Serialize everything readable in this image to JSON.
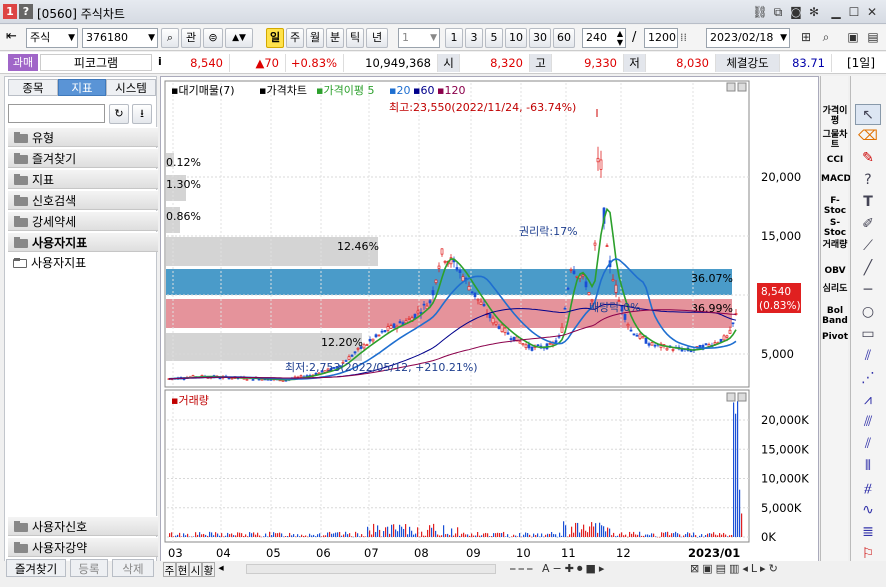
{
  "window": {
    "screen_no": "[0560]",
    "title": "주식차트",
    "badge1": "1",
    "badge2": "?"
  },
  "toolbar": {
    "market": "주식",
    "code": "376180",
    "btn_gwan": "관",
    "periods": [
      "일",
      "주",
      "월",
      "분",
      "틱",
      "년"
    ],
    "active_period": "일",
    "unit_select": "1",
    "minute_buttons": [
      "1",
      "3",
      "5",
      "10",
      "30",
      "60"
    ],
    "count_shown": "240",
    "count_total": "1200",
    "date": "2023/02/18"
  },
  "quote": {
    "tag": "과매",
    "name": "피코그램",
    "info": "i",
    "price": "8,540",
    "change": "▲70",
    "change_pct": "+0.83%",
    "volume": "10,949,368",
    "open_label": "시",
    "open": "8,320",
    "high_label": "고",
    "high": "9,330",
    "low_label": "저",
    "low": "8,030",
    "strength_label": "체결강도",
    "strength": "83.71",
    "period_badge": "[1일]"
  },
  "left_panel": {
    "tabs": [
      "종목",
      "지표",
      "시스템"
    ],
    "active_tab": "지표",
    "groups": [
      "유형",
      "즐겨찾기",
      "지표",
      "신호검색",
      "강세약세",
      "사용자지표"
    ],
    "subitem": "사용자지표",
    "bottom_groups": [
      "사용자신호",
      "사용자강약"
    ]
  },
  "chart_data": [
    {
      "type": "candlestick",
      "legend": [
        "대기매물(7)",
        "가격차트",
        "가격이평 5",
        "20",
        "60",
        "120"
      ],
      "legend_colors": [
        "#000000",
        "#000000",
        "#2ca02c",
        "#1f6fd0",
        "#00008b",
        "#8b004b"
      ],
      "y_ticks": [
        "20,000",
        "15,000",
        "10,000",
        "5,000"
      ],
      "x_ticks": [
        "03",
        "04",
        "05",
        "06",
        "07",
        "08",
        "09",
        "10",
        "11",
        "12",
        "2023/01"
      ],
      "max_annotation": "최고:23,550(2022/11/24, -63.74%)",
      "min_annotation": "최저:2,753(2022/05/12, +210.21%)",
      "rights_annotation": "권리락:17%",
      "dividend_annotation": "배당락:0%",
      "volume_profile": [
        {
          "pct": "0.12%",
          "color": "#cccccc"
        },
        {
          "pct": "1.30%",
          "color": "#cccccc"
        },
        {
          "pct": "0.86%",
          "color": "#cccccc"
        },
        {
          "pct": "12.46%",
          "color": "#cccccc"
        },
        {
          "pct": "36.07%",
          "color": "#2a8ac0"
        },
        {
          "pct": "36.99%",
          "color": "#e0808a"
        },
        {
          "pct": "12.20%",
          "color": "#cccccc"
        }
      ],
      "last_price": "8,540",
      "last_change": "(0.83%)"
    },
    {
      "type": "bar",
      "title": "거래량",
      "y_ticks": [
        "20,000K",
        "15,000K",
        "10,000K",
        "5,000K",
        "0K"
      ]
    }
  ],
  "right_indicators": [
    "가격이평",
    "그물차트",
    "CCI",
    "MACD",
    "F-Stoc",
    "S-Stoc",
    "거래량",
    "OBV",
    "심리도",
    "Bol Band",
    "Pivot"
  ],
  "bottom": {
    "fav": "즐겨찾기",
    "register": "등록",
    "delete": "삭제",
    "view_tabs": [
      "주",
      "현",
      "시",
      "황"
    ]
  },
  "colors": {
    "up": "#e02020",
    "down": "#1a4fd6",
    "accent": "#ffe24a"
  }
}
